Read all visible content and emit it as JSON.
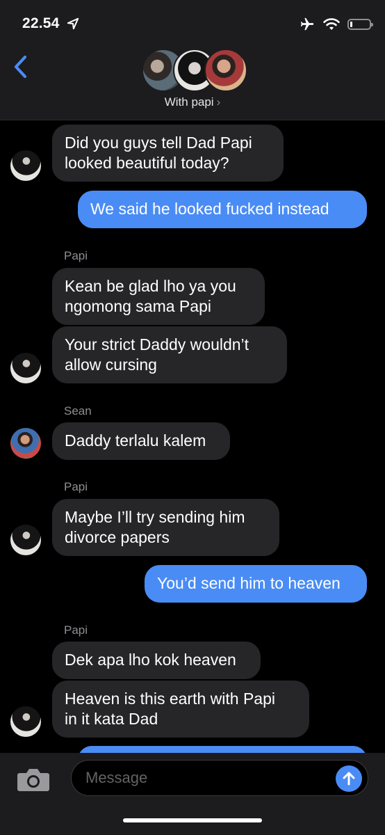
{
  "status": {
    "time": "22.54",
    "icons": [
      "location-arrow-icon",
      "airplane-icon",
      "wifi-icon",
      "battery-icon"
    ],
    "battery_level": 0.1
  },
  "header": {
    "back_icon": "chevron-left-icon",
    "group_label": "With papi",
    "chevron": "›"
  },
  "messages": [
    {
      "type": "in",
      "text_lines": [
        "Did you guys tell Dad Papi",
        "looked beautiful today?"
      ]
    },
    {
      "type": "out",
      "text": "We said he looked fucked instead"
    },
    {
      "sender": "Papi"
    },
    {
      "type": "in",
      "text_lines": [
        "Kean be glad lho ya you",
        "ngomong sama Papi"
      ]
    },
    {
      "type": "in",
      "text_lines": [
        "Your strict Daddy wouldn’t",
        "allow cursing"
      ]
    },
    {
      "sender": "Sean"
    },
    {
      "type": "in",
      "text": "Daddy terlalu kalem"
    },
    {
      "sender": "Papi"
    },
    {
      "type": "in",
      "text_lines": [
        "Maybe I’ll try sending him",
        "divorce papers"
      ]
    },
    {
      "type": "out",
      "text": "You’d send him to heaven"
    },
    {
      "sender": "Papi"
    },
    {
      "type": "in",
      "text": "Dek apa lho kok heaven"
    },
    {
      "type": "in",
      "text_lines": [
        "Heaven is this earth with Papi",
        "in it kata Dad"
      ]
    }
  ],
  "m": {
    "m1a": "Did you guys tell Dad Papi",
    "m1b": "looked beautiful today?",
    "m2": "We said he looked fucked instead",
    "s1": "Papi",
    "m3a": "Kean be glad lho ya you",
    "m3b": "ngomong sama Papi",
    "m4a": "Your strict Daddy wouldn’t",
    "m4b": "allow cursing",
    "s2": "Sean",
    "m5": "Daddy terlalu kalem",
    "s3": "Papi",
    "m6a": "Maybe I’ll try sending him",
    "m6b": "divorce papers",
    "m7": "You’d send him to heaven",
    "s4": "Papi",
    "m8": "Dek apa lho kok heaven",
    "m9a": "Heaven is this earth with Papi",
    "m9b": "in it kata Dad"
  },
  "input": {
    "placeholder": "Message",
    "camera_icon": "camera-icon",
    "send_icon": "arrow-up-icon"
  },
  "colors": {
    "outgoing": "#4a8cf5",
    "incoming": "#262628",
    "background": "#000000",
    "header": "#1c1c1e"
  }
}
